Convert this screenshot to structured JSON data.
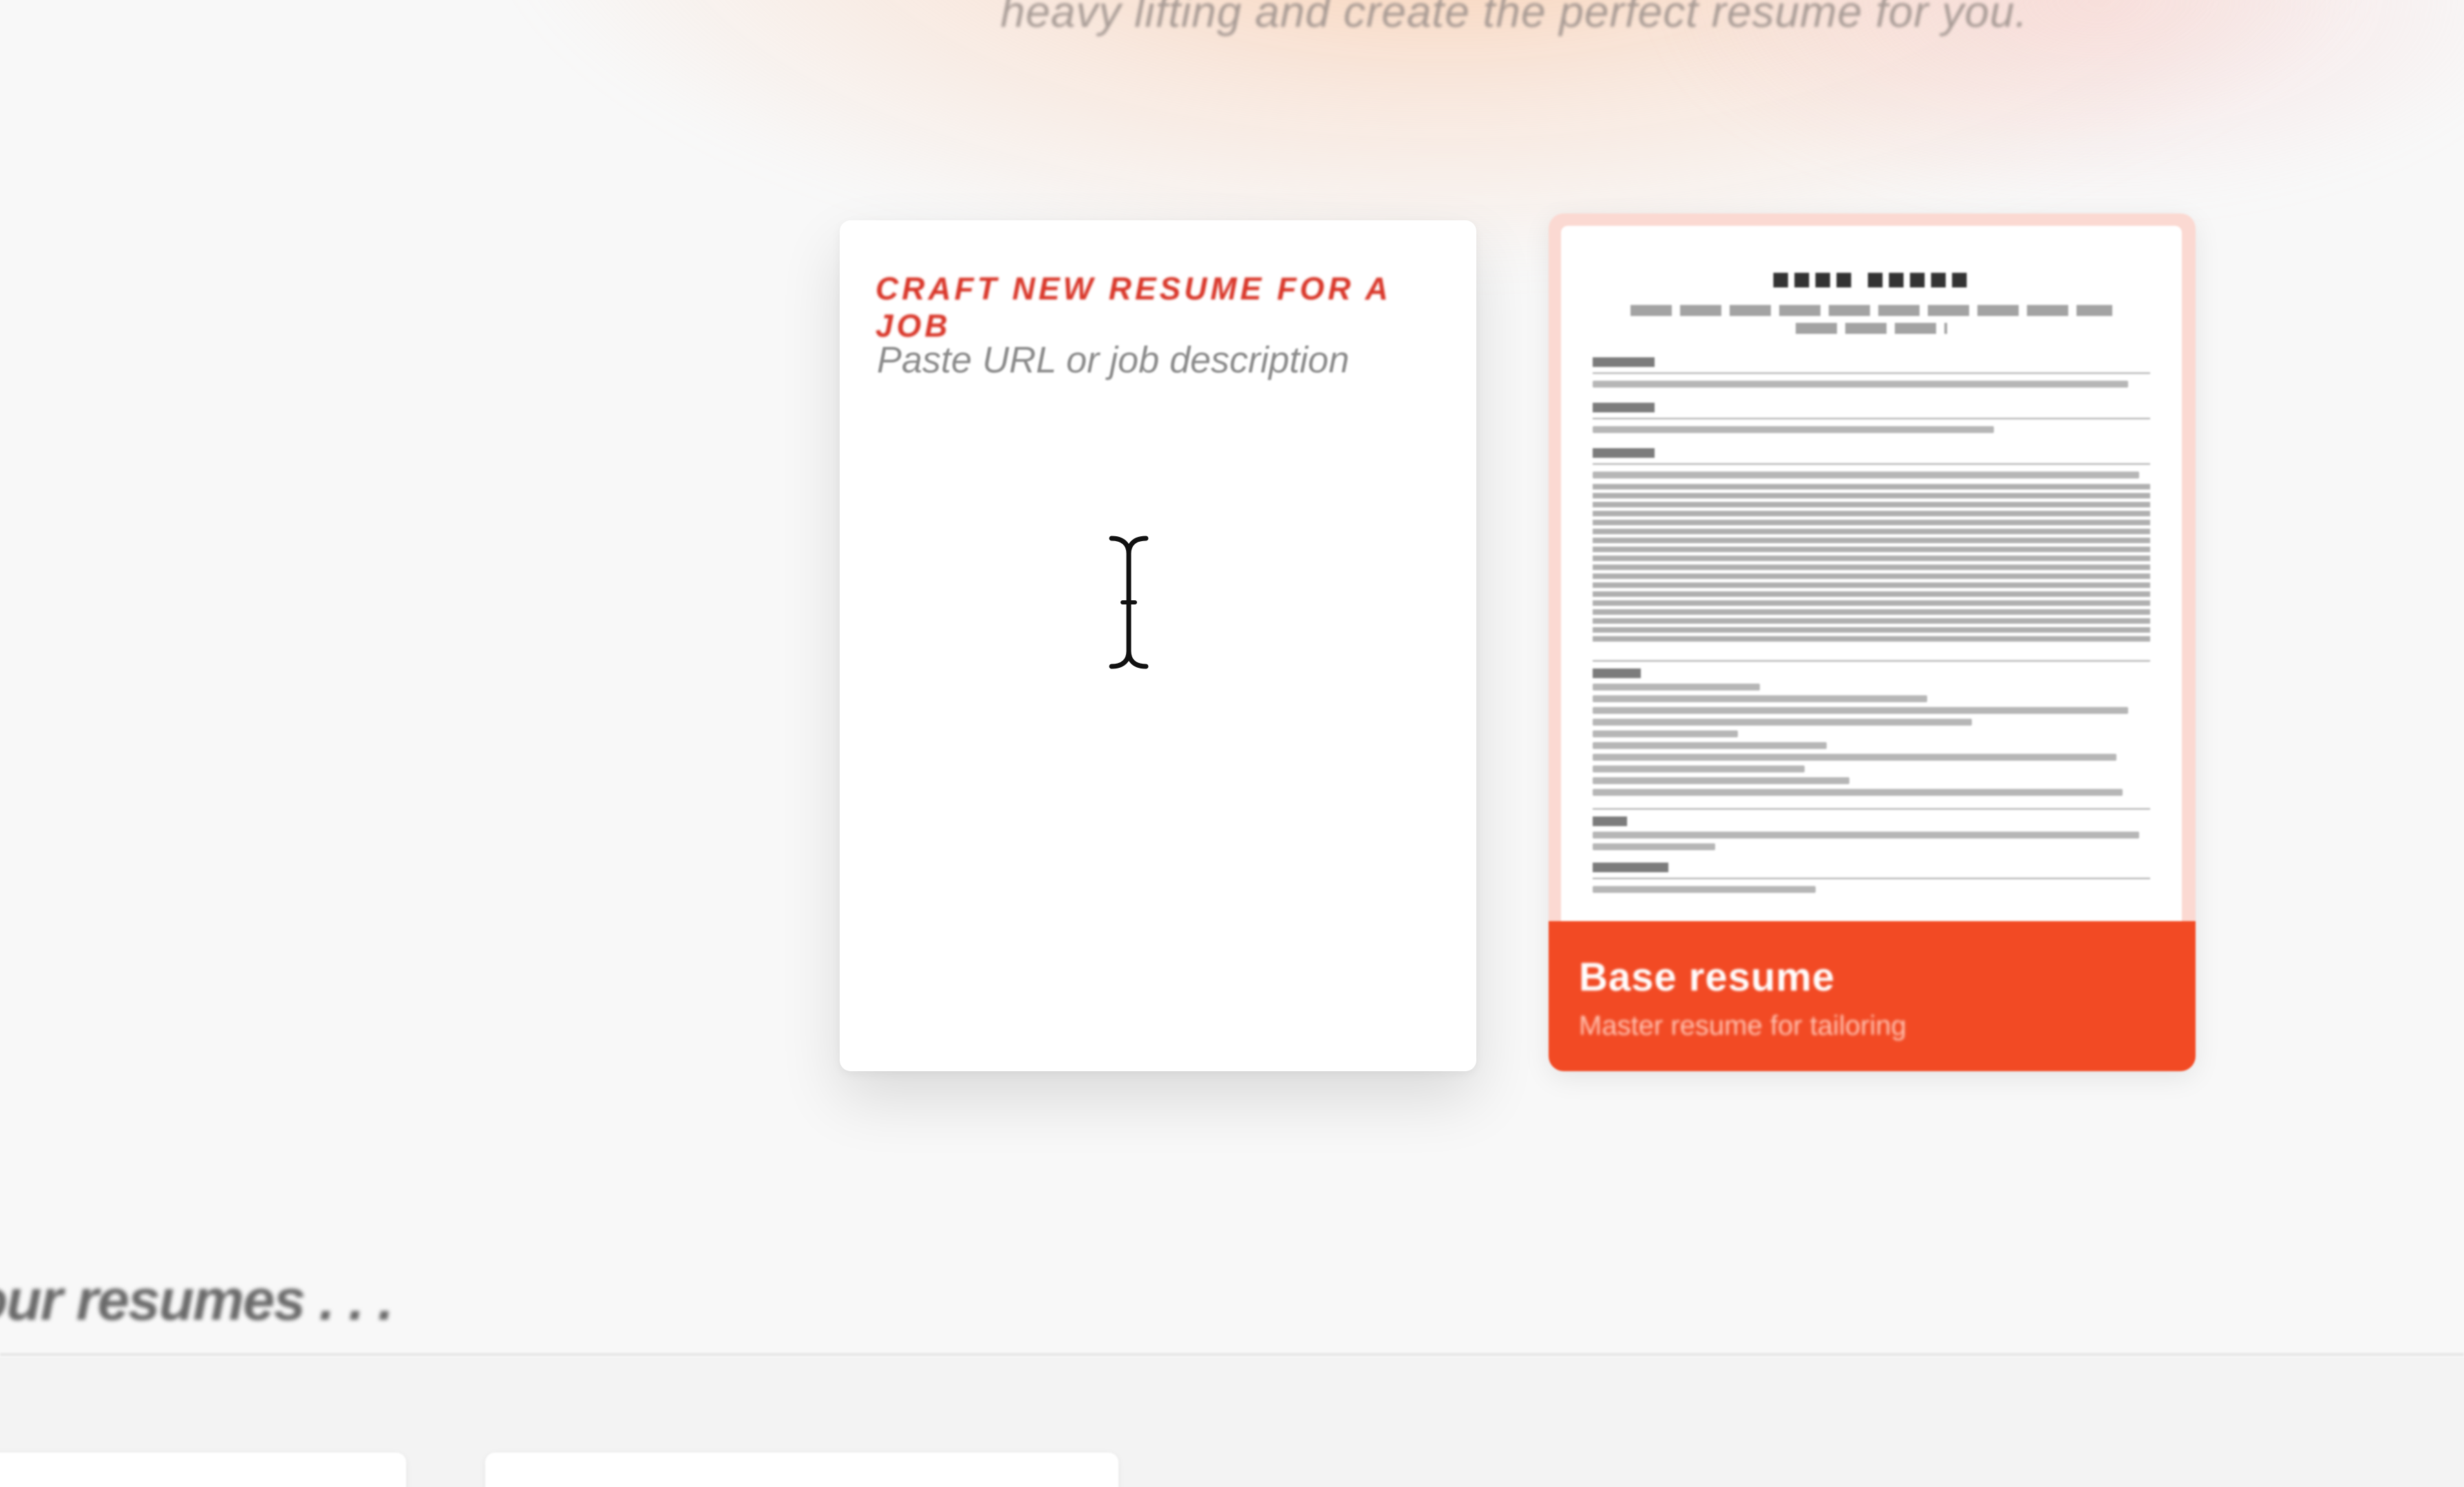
{
  "hero": {
    "subtitle": "heavy lifting and create the perfect resume for you."
  },
  "job_card": {
    "title": "CRAFT NEW RESUME FOR A JOB",
    "input_placeholder": "Paste URL or job description",
    "input_value": ""
  },
  "base_resume_card": {
    "title": "Base resume",
    "subtitle": "Master resume for tailoring"
  },
  "resumes_section": {
    "title": "our resumes . . ."
  },
  "colors": {
    "accent": "#f24a24",
    "card_title": "#d9372a",
    "background": "#f8f8f8"
  },
  "icons": {
    "cursor": "text-cursor-icon"
  }
}
